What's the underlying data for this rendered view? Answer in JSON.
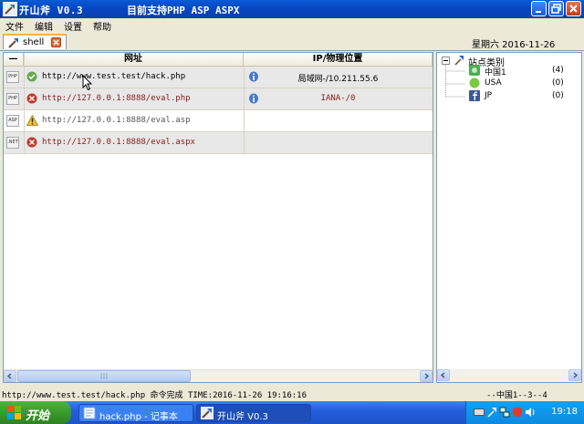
{
  "window": {
    "app_title": "开山斧 V0.3",
    "subtitle": "目前支持PHP ASP ASPX"
  },
  "menu": [
    "文件",
    "编辑",
    "设置",
    "帮助"
  ],
  "tabs": [
    {
      "label": "shell"
    }
  ],
  "header_date": "星期六 2016-11-26",
  "grid": {
    "columns": [
      "—",
      "网址",
      "IP/物理位置"
    ],
    "rows": [
      {
        "type": "PHP",
        "status": "ok",
        "url": "http://www.test.test/hack.php",
        "ip": "局域网-/10.211.55.6"
      },
      {
        "type": "PHP",
        "status": "error",
        "url": "http://127.0.0.1:8888/eval.php",
        "ip": "IANA-/0"
      },
      {
        "type": "ASP",
        "status": "warning",
        "url": "http://127.0.0.1:8888/eval.asp",
        "ip": ""
      },
      {
        "type": ".NET",
        "status": "error",
        "url": "http://127.0.0.1:8888/eval.aspx",
        "ip": ""
      }
    ]
  },
  "tree": {
    "root": "站点类别",
    "items": [
      {
        "name": "中国1",
        "count": "(4)"
      },
      {
        "name": "USA",
        "count": "(0)"
      },
      {
        "name": "JP",
        "count": "(0)"
      }
    ]
  },
  "status": {
    "message": "http://www.test.test/hack.php 命令完成 TIME:2016-11-26 19:16:16",
    "right": "--中国1--3--4"
  },
  "taskbar": {
    "start": "开始",
    "items": [
      "hack.php - 记事本",
      "开山斧 V0.3"
    ],
    "clock": "19:18"
  },
  "colors": {
    "url_error": "#8b1a1a",
    "accent_title": "#0a5ad6"
  }
}
